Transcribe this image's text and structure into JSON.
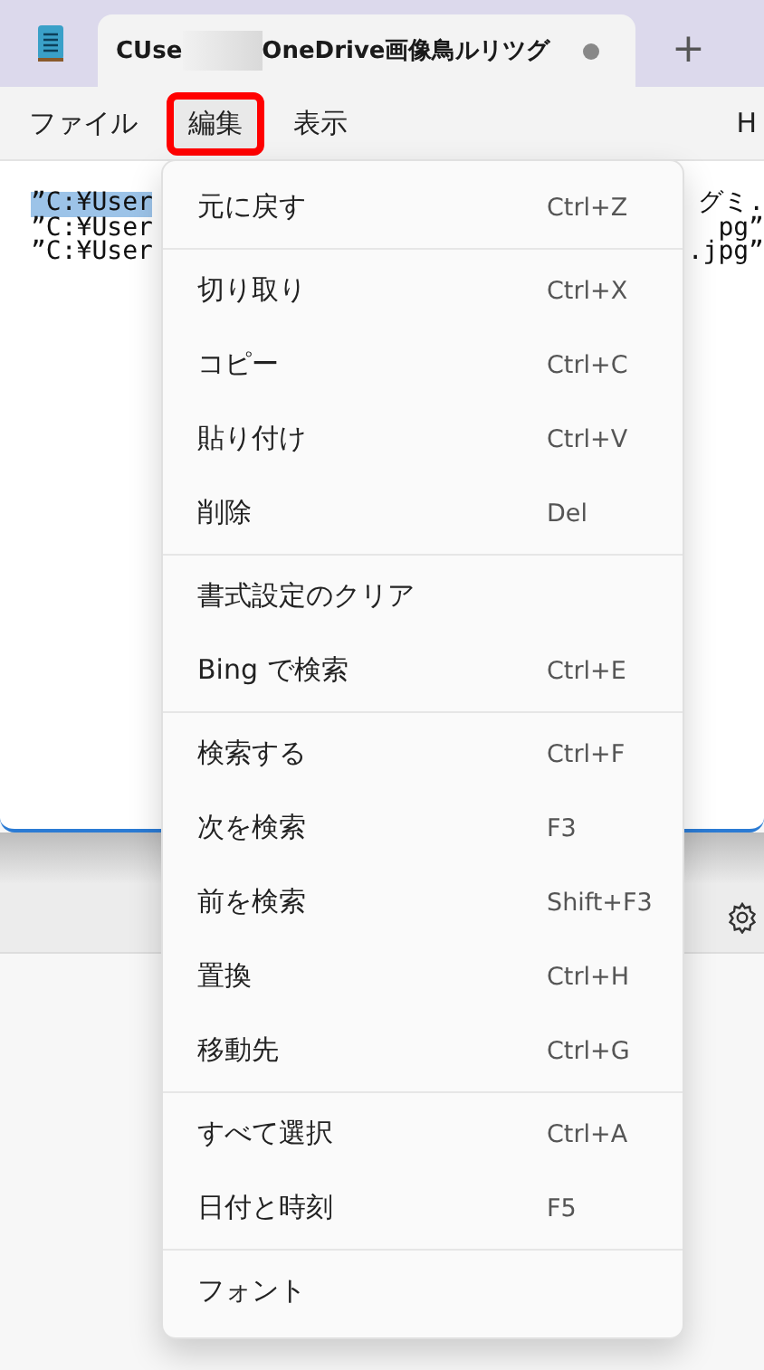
{
  "tab": {
    "title_start": "CUse",
    "title_end": "OneDrive画像鳥ルリツグ",
    "modified": true,
    "new_tab": "+"
  },
  "menu_bar": [
    {
      "label": "ファイル",
      "selected": false
    },
    {
      "label": "編集",
      "selected": true
    },
    {
      "label": "表示",
      "selected": false
    },
    {
      "label": "H",
      "selected": false
    }
  ],
  "editor_lines": [
    {
      "start": "”C:¥User",
      "end": "グミ.",
      "highlighted": true
    },
    {
      "start": "”C:¥User",
      "end": "pg”",
      "highlighted": false
    },
    {
      "start": "”C:¥User",
      "end": ".jpg”",
      "highlighted": false
    }
  ],
  "edit_menu": [
    [
      {
        "label": "元に戻す",
        "shortcut": "Ctrl+Z"
      }
    ],
    [
      {
        "label": "切り取り",
        "shortcut": "Ctrl+X"
      },
      {
        "label": "コピー",
        "shortcut": "Ctrl+C"
      },
      {
        "label": "貼り付け",
        "shortcut": "Ctrl+V"
      },
      {
        "label": "削除",
        "shortcut": "Del"
      }
    ],
    [
      {
        "label": "書式設定のクリア"
      },
      {
        "label": "Bing で検索",
        "shortcut": "Ctrl+E"
      }
    ],
    [
      {
        "label": "検索する",
        "shortcut": "Ctrl+F"
      },
      {
        "label": "次を検索",
        "shortcut": "F3"
      },
      {
        "label": "前を検索",
        "shortcut": "Shift+F3"
      },
      {
        "label": "置換",
        "shortcut": "Ctrl+H"
      },
      {
        "label": "移動先",
        "shortcut": "Ctrl+G"
      }
    ],
    [
      {
        "label": "すべて選択",
        "shortcut": "Ctrl+A"
      },
      {
        "label": "日付と時刻",
        "shortcut": "F5"
      }
    ],
    [
      {
        "label": "フォント"
      }
    ]
  ]
}
